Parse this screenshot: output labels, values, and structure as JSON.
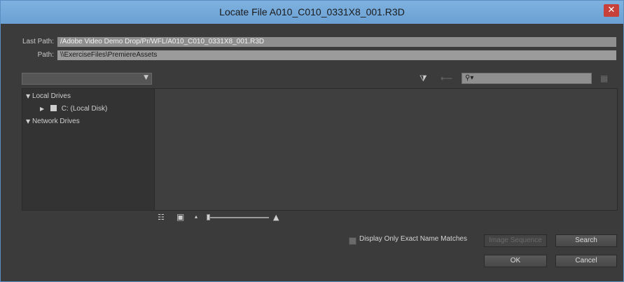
{
  "window": {
    "title": "Locate File A010_C010_0331X8_001.R3D",
    "close_glyph": "✕"
  },
  "last_path": {
    "label": "Last Path:",
    "value": "/Adobe Video Demo Drop/Pr/WFL/A010_C010_0331X8_001.R3D"
  },
  "path": {
    "label": "Path:",
    "value": "\\\\ExerciseFiles\\PremiereAssets"
  },
  "toolbar": {
    "filter_glyph": "⧩",
    "back_glyph": "⟵",
    "search_placeholder": "⚲▾",
    "new_folder_glyph": "▦"
  },
  "tree": {
    "local_drives": "Local Drives",
    "local_disk": "C: (Local Disk)",
    "network_drives": "Network Drives",
    "expanded_glyph": "▼",
    "collapsed_glyph": "▶"
  },
  "view_bar": {
    "list_glyph": "☷",
    "icon_glyph": "▣",
    "small_glyph": "▴",
    "large_glyph": "▲",
    "zoom_level": 0.0
  },
  "options": {
    "exact_match_label": "Display Only Exact Name Matches",
    "exact_match_checked": false
  },
  "buttons": {
    "image_sequence": "Image Sequence",
    "search": "Search",
    "ok": "OK",
    "cancel": "Cancel"
  }
}
